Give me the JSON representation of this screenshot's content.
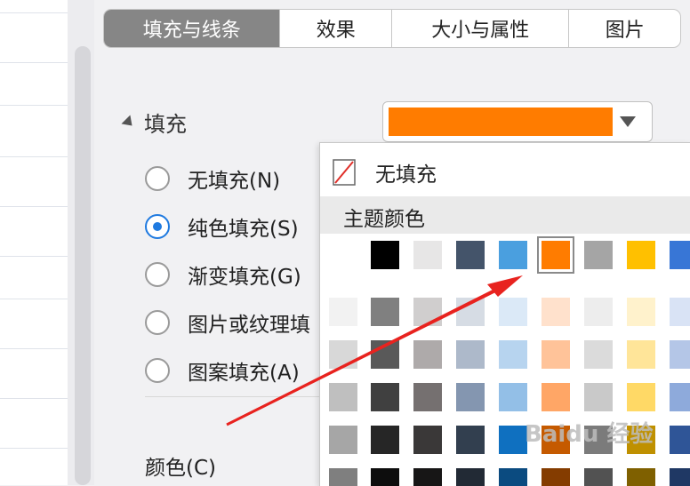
{
  "tabs": [
    {
      "label": "填充与线条",
      "active": true
    },
    {
      "label": "效果",
      "active": false
    },
    {
      "label": "大小与属性",
      "active": false
    },
    {
      "label": "图片",
      "active": false
    }
  ],
  "fill": {
    "section_title": "填充",
    "selected_color": "#ff7c00",
    "options": [
      {
        "label": "无填充(N)",
        "checked": false
      },
      {
        "label": "纯色填充(S)",
        "checked": true
      },
      {
        "label": "渐变填充(G)",
        "checked": false
      },
      {
        "label": "图片或纹理填",
        "checked": false
      },
      {
        "label": "图案填充(A)",
        "checked": false
      }
    ],
    "color_label": "颜色(C)"
  },
  "palette": {
    "no_fill_label": "无填充",
    "theme_header": "主题颜色",
    "theme_row": [
      "#ffffff",
      "#000000",
      "#e7e6e6",
      "#44546a",
      "#4a9fdf",
      "#ff7c00",
      "#a5a5a5",
      "#ffc000",
      "#3876d6"
    ],
    "selected_index": 5,
    "shade_rows": [
      [
        "#f2f2f2",
        "#808080",
        "#d0cece",
        "#d6dce4",
        "#dbe9f7",
        "#ffe1cc",
        "#ededed",
        "#fff2cc",
        "#d9e3f5"
      ],
      [
        "#d8d8d8",
        "#595959",
        "#aeaaaa",
        "#adb9ca",
        "#b7d4ef",
        "#ffc399",
        "#dbdbdb",
        "#ffe599",
        "#b4c6e7"
      ],
      [
        "#bfbfbf",
        "#404040",
        "#757070",
        "#8496b0",
        "#93bfe7",
        "#ffa666",
        "#c9c9c9",
        "#ffd966",
        "#8eaadb"
      ],
      [
        "#a6a6a6",
        "#262626",
        "#3a3838",
        "#323f4f",
        "#0f70c0",
        "#c55a00",
        "#7b7b7b",
        "#bf9000",
        "#2f5597"
      ],
      [
        "#7f7f7f",
        "#0d0d0d",
        "#171616",
        "#222a35",
        "#0b4b80",
        "#843c00",
        "#525252",
        "#7f6000",
        "#1f3864"
      ]
    ]
  },
  "watermark": "Baidu 经验"
}
